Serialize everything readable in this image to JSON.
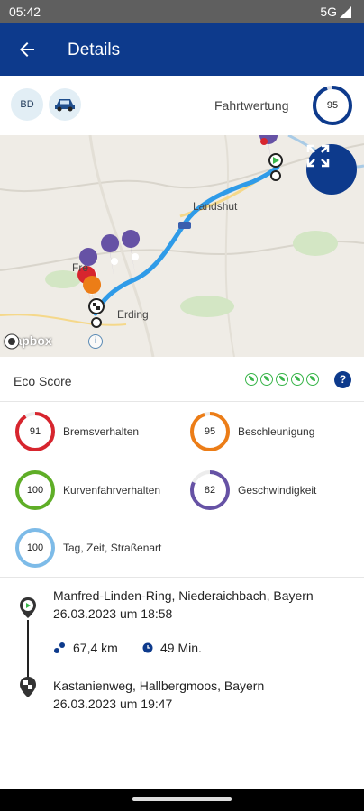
{
  "status_bar": {
    "time": "05:42",
    "network": "5G"
  },
  "header": {
    "title": "Details"
  },
  "summary": {
    "driver_initials": "BD",
    "rating_label": "Fahrtwertung",
    "rating_value": "95"
  },
  "map": {
    "places": [
      "Landshut",
      "Erding",
      "Fre"
    ],
    "attribution": "mapbox",
    "info_symbol": "i"
  },
  "eco": {
    "label": "Eco Score",
    "leaves": 5,
    "help_symbol": "?"
  },
  "scores": [
    {
      "value": "91",
      "label": "Bremsverhalten",
      "color": "#d7252e",
      "fraction": 0.91
    },
    {
      "value": "95",
      "label": "Beschleunigung",
      "color": "#ec7d17",
      "fraction": 0.95
    },
    {
      "value": "100",
      "label": "Kurvenfahrverhalten",
      "color": "#5fae27",
      "fraction": 1.0
    },
    {
      "value": "82",
      "label": "Geschwindigkeit",
      "color": "#6652a5",
      "fraction": 0.82
    },
    {
      "value": "100",
      "label": "Tag, Zeit, Straßenart",
      "color": "#7dbbe8",
      "fraction": 1.0
    }
  ],
  "trip": {
    "start": {
      "address": "Manfred-Linden-Ring, Niederaichbach, Bayern",
      "time": "26.03.2023 um 18:58"
    },
    "distance": "67,4 km",
    "duration": "49 Min.",
    "end": {
      "address": "Kastanienweg, Hallbergmoos, Bayern",
      "time": "26.03.2023 um 19:47"
    }
  },
  "colors": {
    "primary": "#0d3a8c",
    "route": "#2f9be8",
    "eco": "#39b54a"
  }
}
